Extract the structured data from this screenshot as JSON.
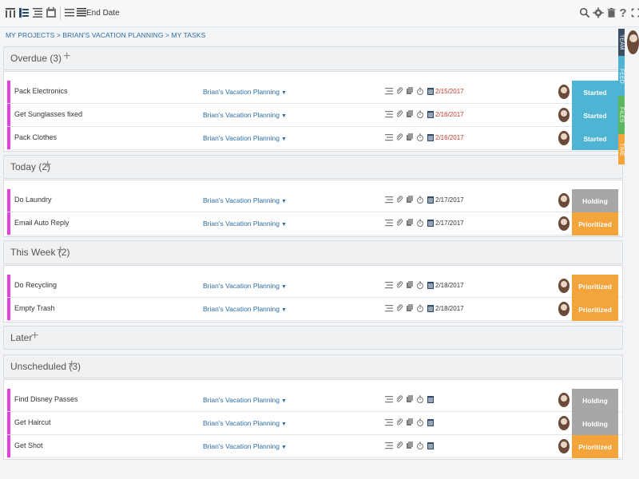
{
  "toolbar": {
    "sort_label": "End Date",
    "left_icons": [
      "board-view-icon",
      "list-view-icon",
      "outline-view-icon",
      "calendar-view-icon",
      "sort-icon"
    ],
    "right_icons": [
      "search-icon",
      "gear-icon",
      "trash-icon",
      "help-icon",
      "expand-icon"
    ]
  },
  "breadcrumb": {
    "items": [
      "MY PROJECTS",
      "BRIAN'S VACATION PLANNING",
      "MY TASKS"
    ],
    "separator": " > "
  },
  "sections": [
    {
      "title": "Overdue (3)",
      "plus": "+",
      "tasks": [
        {
          "name": "Pack Electronics",
          "project": "Brian's Vacation Planning",
          "date": "2/15/2017",
          "date_state": "overdue",
          "status": "Started"
        },
        {
          "name": "Get Sunglasses fixed",
          "project": "Brian's Vacation Planning",
          "date": "2/16/2017",
          "date_state": "overdue",
          "status": "Started"
        },
        {
          "name": "Pack Clothes",
          "project": "Brian's Vacation Planning",
          "date": "2/16/2017",
          "date_state": "overdue",
          "status": "Started"
        }
      ]
    },
    {
      "title": "Today (2)",
      "plus": "+",
      "tasks": [
        {
          "name": "Do Laundry",
          "project": "Brian's Vacation Planning",
          "date": "2/17/2017",
          "date_state": "normal",
          "status": "Holding"
        },
        {
          "name": "Email Auto Reply",
          "project": "Brian's Vacation Planning",
          "date": "2/17/2017",
          "date_state": "normal",
          "status": "Prioritized"
        }
      ]
    },
    {
      "title": "This Week (2)",
      "plus": "+",
      "tasks": [
        {
          "name": "Do Recycling",
          "project": "Brian's Vacation Planning",
          "date": "2/18/2017",
          "date_state": "normal",
          "status": "Prioritized"
        },
        {
          "name": "Empty Trash",
          "project": "Brian's Vacation Planning",
          "date": "2/18/2017",
          "date_state": "normal",
          "status": "Prioritized"
        }
      ]
    },
    {
      "title": "Later",
      "plus": "+",
      "tasks": []
    },
    {
      "title": "Unscheduled (3)",
      "plus": "+",
      "tasks": [
        {
          "name": "Find Disney Passes",
          "project": "Brian's Vacation Planning",
          "date": "",
          "date_state": "normal",
          "status": "Holding"
        },
        {
          "name": "Get Haircut",
          "project": "Brian's Vacation Planning",
          "date": "",
          "date_state": "normal",
          "status": "Holding"
        },
        {
          "name": "Get Shot",
          "project": "Brian's Vacation Planning",
          "date": "",
          "date_state": "normal",
          "status": "Prioritized"
        }
      ]
    }
  ],
  "side_tabs": [
    "TEAM",
    "FEED",
    "FILES",
    "TIME"
  ],
  "colors": {
    "accent_bar": "#e83fe0",
    "started": "#4fb4d4",
    "holding": "#a7a7a7",
    "prioritized": "#f3a43b",
    "overdue_date": "#c0392b",
    "link": "#2e6da4"
  }
}
